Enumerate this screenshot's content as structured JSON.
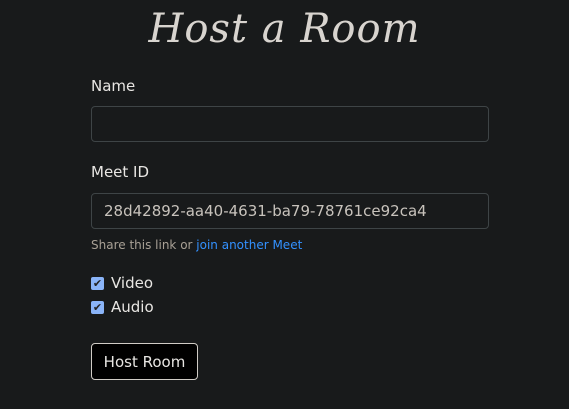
{
  "title": "Host a Room",
  "name_field": {
    "label": "Name",
    "value": ""
  },
  "meet_id_field": {
    "label": "Meet ID",
    "value": "28d42892-aa40-4631-ba79-78761ce92ca4"
  },
  "help": {
    "prefix": "Share this link or ",
    "link": "join another Meet"
  },
  "checkboxes": [
    {
      "label": "Video",
      "checked": true
    },
    {
      "label": "Audio",
      "checked": true
    }
  ],
  "submit_label": "Host Room"
}
